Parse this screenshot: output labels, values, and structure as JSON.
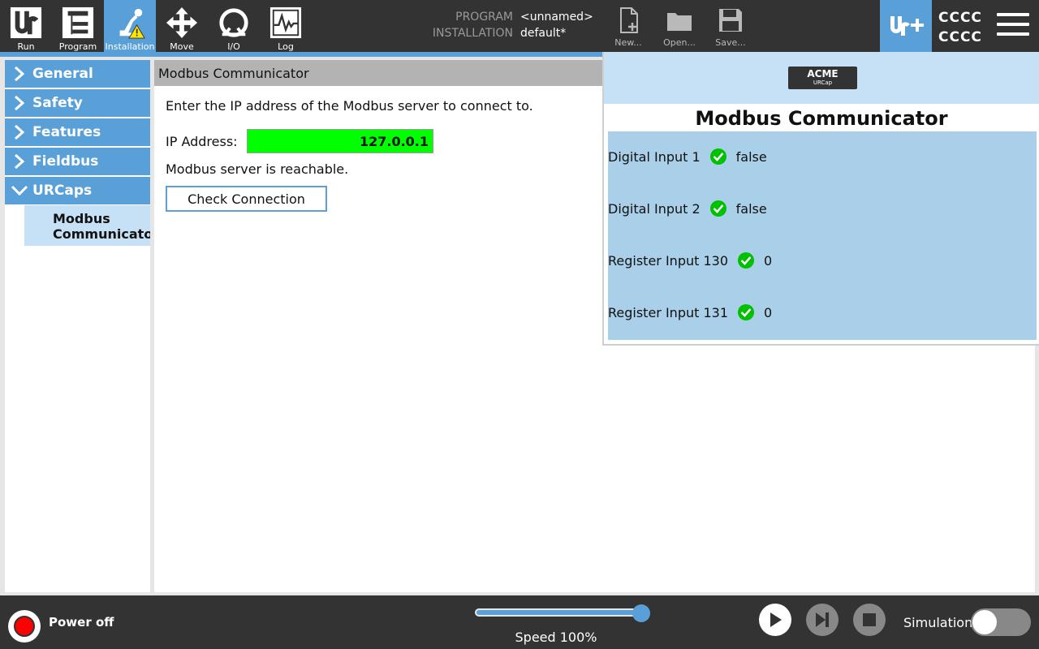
{
  "colors": {
    "accent": "#5aa0d8",
    "topbar": "#333333",
    "ok_green": "#00c000",
    "ip_bg": "#00ff00",
    "power_red": "#ff0000"
  },
  "topbar": {
    "nav": [
      {
        "label": "Run",
        "icon": "ur-logo-icon"
      },
      {
        "label": "Program",
        "icon": "program-tree-icon"
      },
      {
        "label": "Installation",
        "icon": "robot-arm-warning-icon"
      },
      {
        "label": "Move",
        "icon": "move-arrows-icon"
      },
      {
        "label": "I/O",
        "icon": "io-icon"
      },
      {
        "label": "Log",
        "icon": "log-graph-icon"
      }
    ],
    "program_label": "PROGRAM",
    "installation_label": "INSTALLATION",
    "program_value": "<unnamed>",
    "installation_value": "default*",
    "file": [
      {
        "label": "New...",
        "icon": "new-file-icon"
      },
      {
        "label": "Open...",
        "icon": "folder-icon"
      },
      {
        "label": "Save...",
        "icon": "save-icon"
      }
    ],
    "user_line1": "CCCC",
    "user_line2": "CCCC"
  },
  "sidebar": {
    "items": [
      {
        "label": "General",
        "expanded": false
      },
      {
        "label": "Safety",
        "expanded": false
      },
      {
        "label": "Features",
        "expanded": false
      },
      {
        "label": "Fieldbus",
        "expanded": false
      },
      {
        "label": "URCaps",
        "expanded": true
      }
    ],
    "sub_item": {
      "line1": "Modbus",
      "line2": "Communicato"
    }
  },
  "main": {
    "header": "Modbus Communicator",
    "instruction": "Enter the IP address of the Modbus server to connect to.",
    "ip_label": "IP Address:",
    "ip_value": "127.0.0.1",
    "status": "Modbus server is reachable.",
    "check_button": "Check Connection"
  },
  "panel": {
    "logo_main": "ACME",
    "logo_sub": "URCap",
    "title": "Modbus Communicator",
    "registers": [
      {
        "name": "Digital Input 1",
        "value": "false"
      },
      {
        "name": "Digital Input 2",
        "value": "false"
      },
      {
        "name": "Register Input 130",
        "value": "0"
      },
      {
        "name": "Register Input 131",
        "value": "0"
      }
    ]
  },
  "bottombar": {
    "power_label": "Power off",
    "speed_label": "Speed 100%",
    "speed_fraction": 1.0,
    "simulation_label": "Simulation",
    "simulation_on": false
  }
}
